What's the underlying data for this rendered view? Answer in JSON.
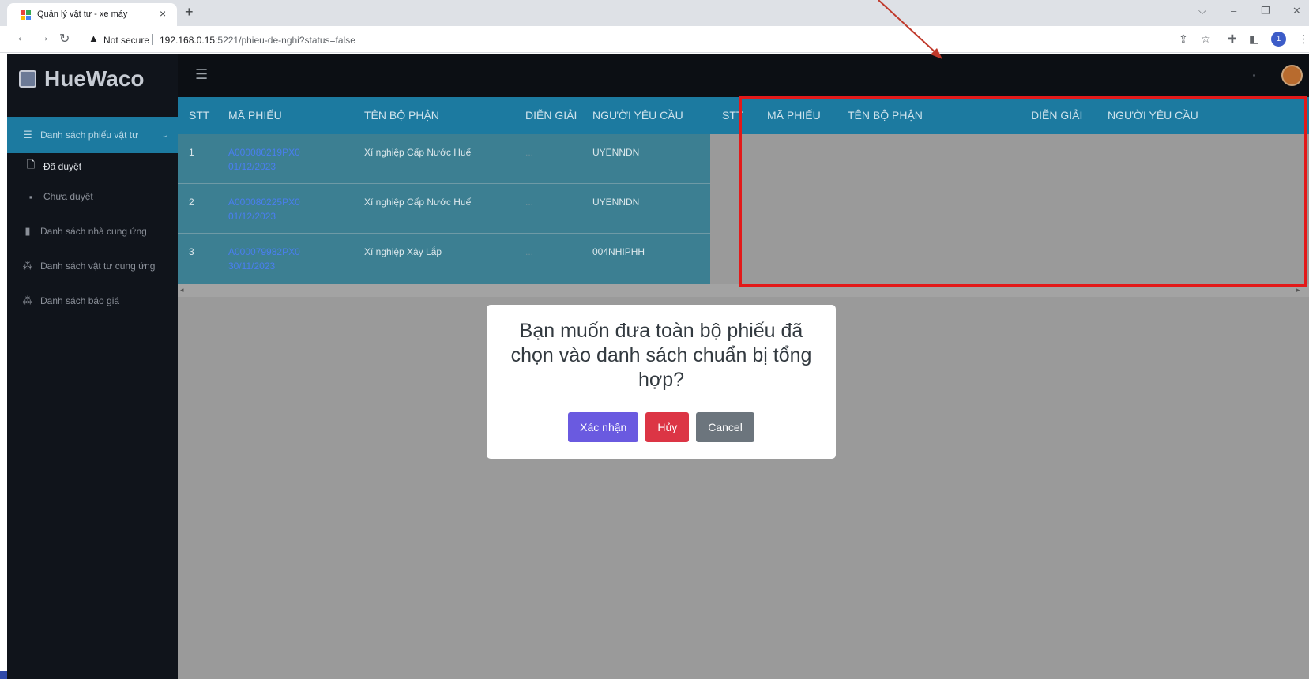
{
  "browser": {
    "tab_title": "Quản lý vật tư - xe máy",
    "tab_close": "×",
    "new_tab": "+",
    "not_secure": "Not secure",
    "url_host": "192.168.0.15",
    "url_path": ":5221/phieu-de-nghi?status=false",
    "profile_initial": "1"
  },
  "sidebar": {
    "brand": "HueWaco",
    "items": [
      {
        "label": "Danh sách phiếu vật tư",
        "icon": "list-icon"
      },
      {
        "label": "Đã duyệt",
        "icon": "document-icon"
      },
      {
        "label": "Chưa duyệt",
        "icon": "document-fill-icon"
      },
      {
        "label": "Danh sách nhà cung ứng",
        "icon": "bar-chart-icon"
      },
      {
        "label": "Danh sách vật tư cung ứng",
        "icon": "nodes-icon"
      },
      {
        "label": "Danh sách báo giá",
        "icon": "nodes-icon"
      }
    ]
  },
  "table": {
    "columns": [
      "STT",
      "MÃ PHIẾU",
      "TÊN BỘ PHẬN",
      "DIỄN GIẢI",
      "NGƯỜI YÊU CẦU"
    ],
    "rows": [
      {
        "stt": "1",
        "code": "A000080219PX0",
        "date": "01/12/2023",
        "dept": "Xí nghiệp Cấp Nước Huế",
        "desc": "...",
        "requester": "UYENNDN"
      },
      {
        "stt": "2",
        "code": "A000080225PX0",
        "date": "01/12/2023",
        "dept": "Xí nghiệp Cấp Nước Huế",
        "desc": "...",
        "requester": "UYENNDN"
      },
      {
        "stt": "3",
        "code": "A000079982PX0",
        "date": "30/11/2023",
        "dept": "Xí nghiệp Xây Lắp",
        "desc": "...",
        "requester": "004NHIPHH"
      }
    ]
  },
  "modal": {
    "message": "Bạn muốn đưa toàn bộ phiếu đã chọn vào danh sách chuẩn bị tổng hợp?",
    "confirm": "Xác nhận",
    "cancel_vi": "Hủy",
    "cancel": "Cancel"
  },
  "colors": {
    "accent": "#1c7aa0",
    "confirm": "#6a5ae0",
    "danger": "#dc3545",
    "secondary": "#6c757d",
    "annotation": "#e31919"
  }
}
